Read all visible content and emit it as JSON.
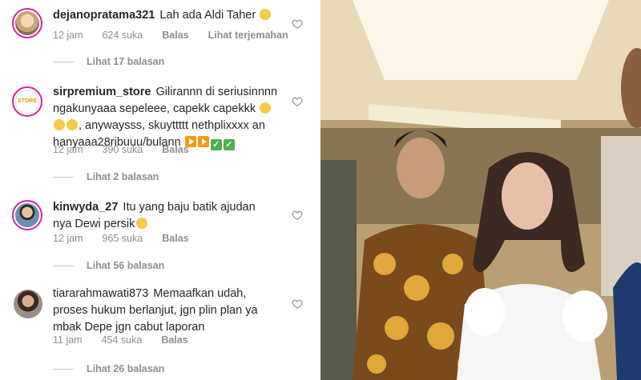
{
  "comments": [
    {
      "username": "dejanopratama321",
      "text": "Lah ada Aldi Taher",
      "time": "12 jam",
      "likes": "624 suka",
      "reply": "Balas",
      "translate": "Lihat terjemahan",
      "replies": "Lihat 17 balasan"
    },
    {
      "username": "sirpremium_store",
      "text": "Gilirannn di seriusinnnn ngakunyaaa sepeleee, capekk capekkk",
      "text2": ", anywaysss, skuyttttt nethplixxxx an hanyaaa28ribuuu/bulann",
      "avatar_text": "STORE",
      "time": "12 jam",
      "likes": "390 suka",
      "reply": "Balas",
      "replies": "Lihat 2 balasan"
    },
    {
      "username": "kinwyda_27",
      "text": "Itu yang baju batik ajudan nya Dewi persik",
      "time": "12 jam",
      "likes": "965 suka",
      "reply": "Balas",
      "replies": "Lihat 56 balasan"
    },
    {
      "username": "tiararahmawati873",
      "text": "Memaafkan udah, proses hukum berlanjut, jgn plin plan ya mbak Depe jgn cabut laporan",
      "time": "11 jam",
      "likes": "454 suka",
      "reply": "Balas",
      "replies": "Lihat 26 balasan"
    }
  ],
  "icons": {
    "like": "heart-outline-icon"
  },
  "colors": {
    "ring": "#d6249f",
    "meta": "#8e8e8e",
    "text": "#262626"
  }
}
